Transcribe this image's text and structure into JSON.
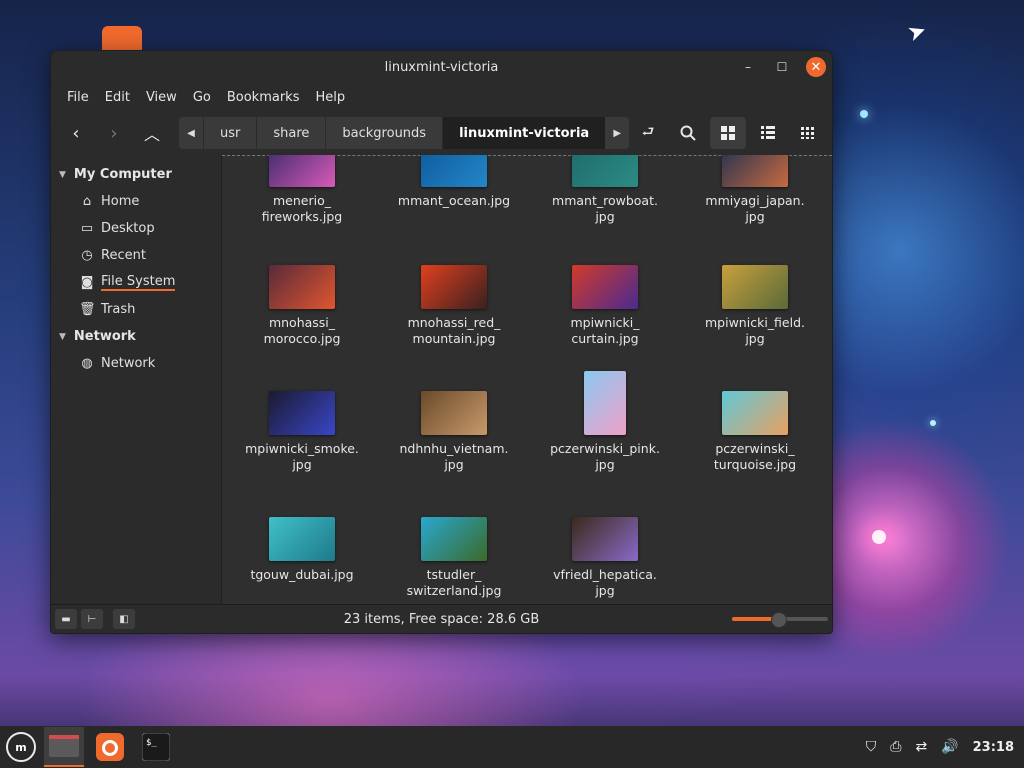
{
  "window": {
    "title": "linuxmint-victoria",
    "controls": {
      "minimize": "–",
      "maximize": "☐",
      "close": "✕"
    }
  },
  "menubar": [
    "File",
    "Edit",
    "View",
    "Go",
    "Bookmarks",
    "Help"
  ],
  "toolbar": {
    "breadcrumbs": [
      "usr",
      "share",
      "backgrounds",
      "linuxmint-victoria"
    ],
    "active_crumb": "linuxmint-victoria"
  },
  "sidebar": {
    "sections": [
      {
        "label": "My Computer",
        "items": [
          {
            "label": "Home",
            "icon": "home-icon"
          },
          {
            "label": "Desktop",
            "icon": "desktop-icon"
          },
          {
            "label": "Recent",
            "icon": "clock-icon"
          },
          {
            "label": "File System",
            "icon": "drive-icon",
            "active": true
          },
          {
            "label": "Trash",
            "icon": "trash-icon"
          }
        ]
      },
      {
        "label": "Network",
        "items": [
          {
            "label": "Network",
            "icon": "globe-icon"
          }
        ]
      }
    ]
  },
  "files": [
    {
      "name_lines": [
        "menerio_",
        "fireworks.jpg"
      ],
      "colors": [
        "#3a2a6a",
        "#d85ab8"
      ]
    },
    {
      "name_lines": [
        "mmant_ocean.jpg"
      ],
      "colors": [
        "#0d5a9a",
        "#2486c8"
      ]
    },
    {
      "name_lines": [
        "mmant_rowboat.",
        "jpg"
      ],
      "colors": [
        "#1e6a6a",
        "#2c8c84"
      ]
    },
    {
      "name_lines": [
        "mmiyagi_japan.",
        "jpg"
      ],
      "colors": [
        "#203050",
        "#c86a40"
      ]
    },
    {
      "name_lines": [
        "mnohassi_",
        "morocco.jpg"
      ],
      "colors": [
        "#5a2a3a",
        "#e0562e"
      ]
    },
    {
      "name_lines": [
        "mnohassi_red_",
        "mountain.jpg"
      ],
      "colors": [
        "#e0401e",
        "#3a2020"
      ]
    },
    {
      "name_lines": [
        "mpiwnicki_",
        "curtain.jpg"
      ],
      "colors": [
        "#d23a2a",
        "#4a2a90"
      ]
    },
    {
      "name_lines": [
        "mpiwnicki_field.",
        "jpg"
      ],
      "colors": [
        "#c8a03c",
        "#5a6a3a"
      ]
    },
    {
      "name_lines": [
        "mpiwnicki_smoke.",
        "jpg"
      ],
      "colors": [
        "#1a1a30",
        "#3a46c8"
      ]
    },
    {
      "name_lines": [
        "ndhnhu_vietnam.",
        "jpg"
      ],
      "colors": [
        "#6a4a2a",
        "#c89a6a"
      ]
    },
    {
      "name_lines": [
        "pczerwinski_pink.",
        "jpg"
      ],
      "colors": [
        "#8ac8f0",
        "#f0a0c8"
      ]
    },
    {
      "name_lines": [
        "pczerwinski_",
        "turquoise.jpg"
      ],
      "colors": [
        "#60c8d8",
        "#e8a060"
      ]
    },
    {
      "name_lines": [
        "tgouw_dubai.jpg"
      ],
      "colors": [
        "#40c0c8",
        "#1e7a8a"
      ]
    },
    {
      "name_lines": [
        "tstudler_",
        "switzerland.jpg"
      ],
      "colors": [
        "#2aa8d0",
        "#3a6a2a"
      ]
    },
    {
      "name_lines": [
        "vfriedl_hepatica.",
        "jpg"
      ],
      "colors": [
        "#3a2a1a",
        "#8a6ac8"
      ]
    }
  ],
  "status": {
    "text": "23 items, Free space: 28.6 GB",
    "zoom_level": 0.48
  },
  "accent_color": "#f06a2e",
  "panel": {
    "menu_icon": "mint-logo-icon",
    "tasks": [
      "files-icon",
      "firefox-icon",
      "terminal-icon"
    ],
    "tray": [
      "shield-icon",
      "printer-icon",
      "network-icon",
      "volume-icon"
    ],
    "clock": "23:18"
  }
}
